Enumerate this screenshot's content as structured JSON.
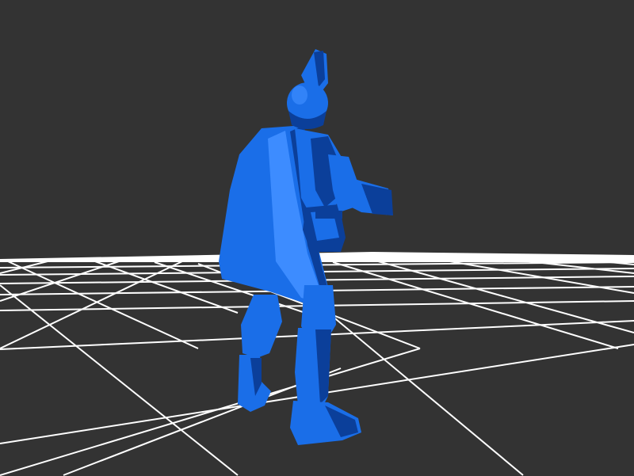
{
  "viewport": {
    "background_color": "#333333",
    "grid_color": "#ffffff",
    "model_color": "#1a6ee8",
    "model_shadow_color": "#0b3f9a",
    "model_highlight_color": "#3d8cff"
  },
  "scene": {
    "model_icon": "armored-knight-model",
    "grid_icon": "ground-grid"
  }
}
